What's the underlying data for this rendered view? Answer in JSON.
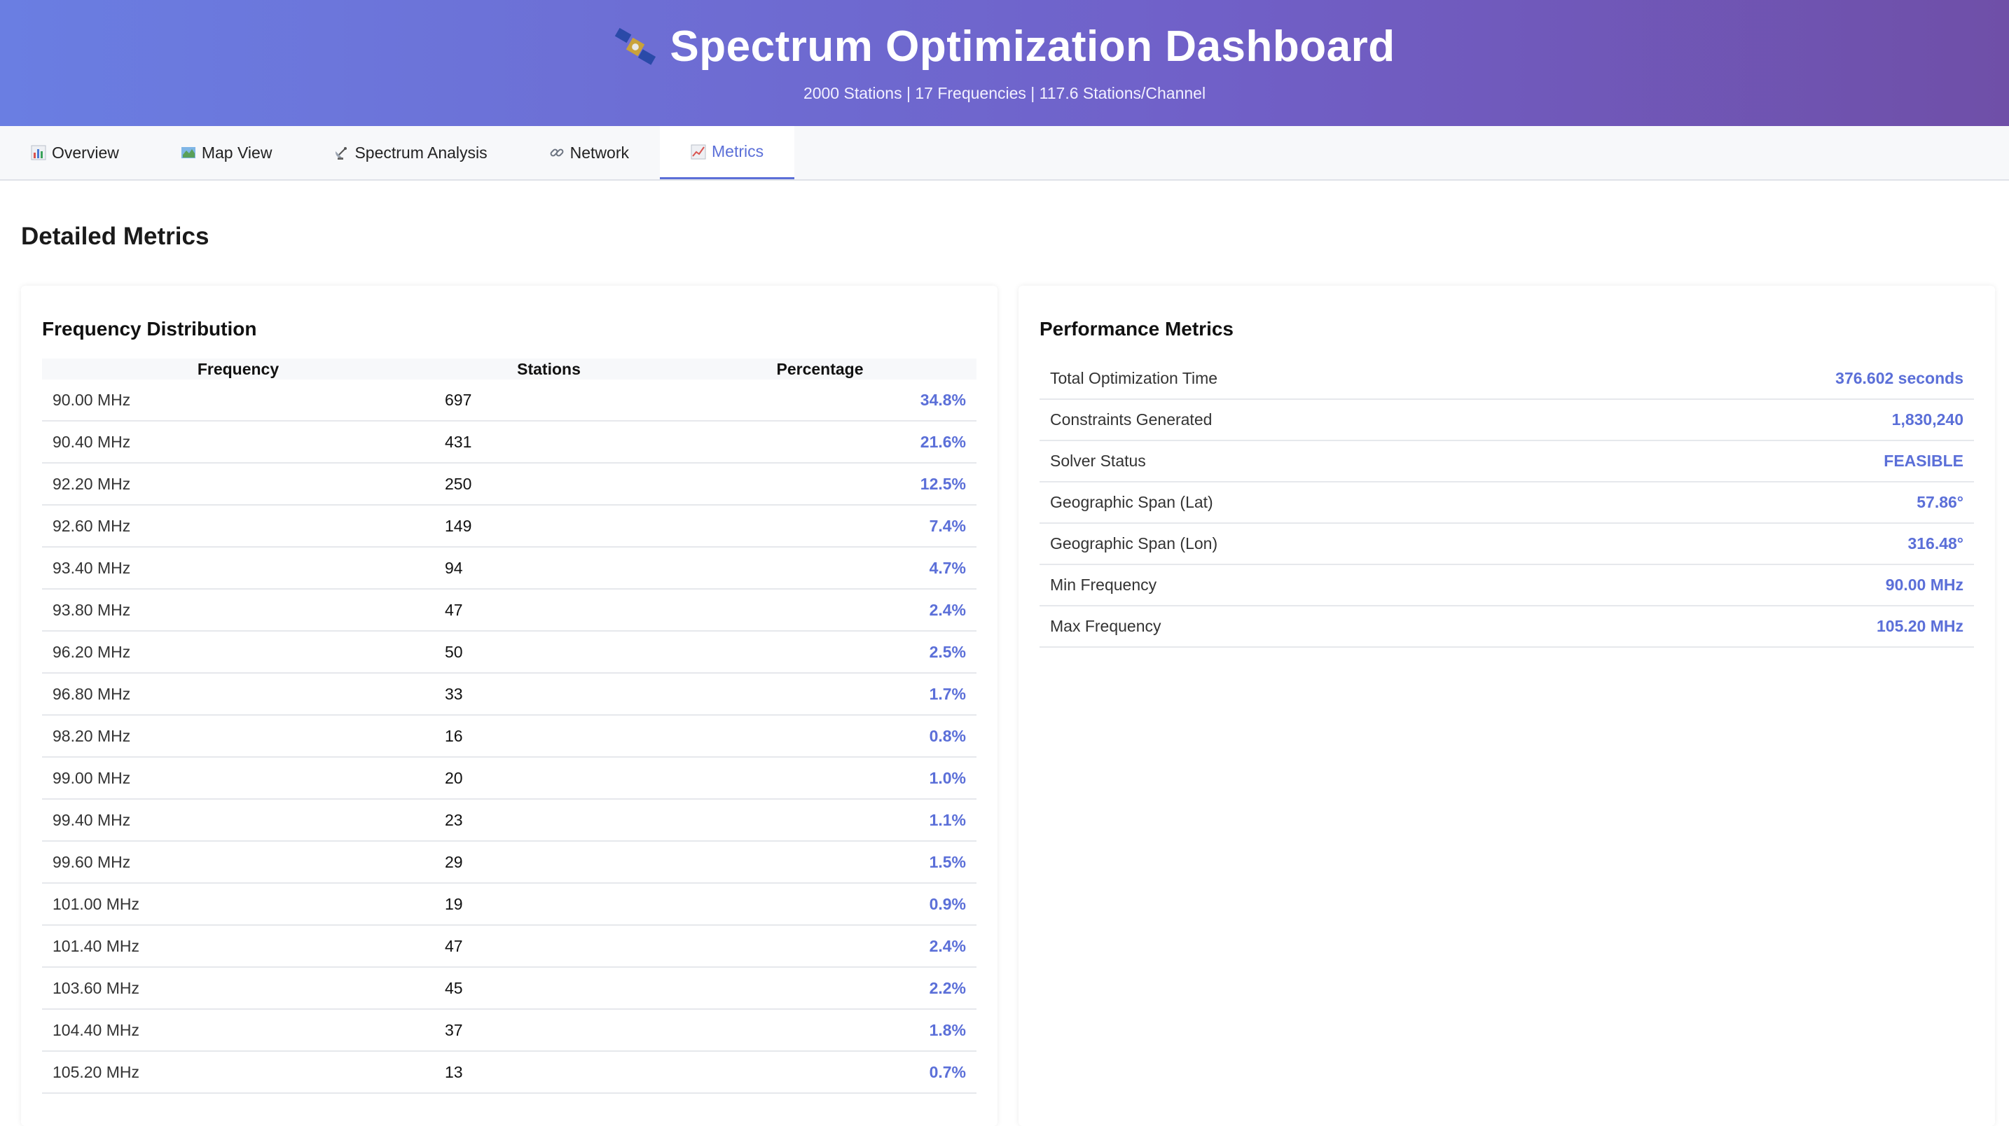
{
  "header": {
    "title": "Spectrum Optimization Dashboard",
    "subtitle": "2000 Stations | 17 Frequencies | 117.6 Stations/Channel",
    "icon": "satellite-icon"
  },
  "tabs": [
    {
      "label": "Overview",
      "icon": "bar-chart-icon"
    },
    {
      "label": "Map View",
      "icon": "map-icon"
    },
    {
      "label": "Spectrum Analysis",
      "icon": "satellite-dish-icon"
    },
    {
      "label": "Network",
      "icon": "link-icon"
    },
    {
      "label": "Metrics",
      "icon": "line-chart-icon",
      "active": true
    }
  ],
  "page_title": "Detailed Metrics",
  "frequency_distribution": {
    "title": "Frequency Distribution",
    "columns": [
      "Frequency",
      "Stations",
      "Percentage"
    ],
    "rows": [
      {
        "frequency": "90.00 MHz",
        "stations": "697",
        "percentage": "34.8%"
      },
      {
        "frequency": "90.40 MHz",
        "stations": "431",
        "percentage": "21.6%"
      },
      {
        "frequency": "92.20 MHz",
        "stations": "250",
        "percentage": "12.5%"
      },
      {
        "frequency": "92.60 MHz",
        "stations": "149",
        "percentage": "7.4%"
      },
      {
        "frequency": "93.40 MHz",
        "stations": "94",
        "percentage": "4.7%"
      },
      {
        "frequency": "93.80 MHz",
        "stations": "47",
        "percentage": "2.4%"
      },
      {
        "frequency": "96.20 MHz",
        "stations": "50",
        "percentage": "2.5%"
      },
      {
        "frequency": "96.80 MHz",
        "stations": "33",
        "percentage": "1.7%"
      },
      {
        "frequency": "98.20 MHz",
        "stations": "16",
        "percentage": "0.8%"
      },
      {
        "frequency": "99.00 MHz",
        "stations": "20",
        "percentage": "1.0%"
      },
      {
        "frequency": "99.40 MHz",
        "stations": "23",
        "percentage": "1.1%"
      },
      {
        "frequency": "99.60 MHz",
        "stations": "29",
        "percentage": "1.5%"
      },
      {
        "frequency": "101.00 MHz",
        "stations": "19",
        "percentage": "0.9%"
      },
      {
        "frequency": "101.40 MHz",
        "stations": "47",
        "percentage": "2.4%"
      },
      {
        "frequency": "103.60 MHz",
        "stations": "45",
        "percentage": "2.2%"
      },
      {
        "frequency": "104.40 MHz",
        "stations": "37",
        "percentage": "1.8%"
      },
      {
        "frequency": "105.20 MHz",
        "stations": "13",
        "percentage": "0.7%"
      }
    ]
  },
  "performance_metrics": {
    "title": "Performance Metrics",
    "items": [
      {
        "label": "Total Optimization Time",
        "value": "376.602 seconds"
      },
      {
        "label": "Constraints Generated",
        "value": "1,830,240"
      },
      {
        "label": "Solver Status",
        "value": "FEASIBLE"
      },
      {
        "label": "Geographic Span (Lat)",
        "value": "57.86°"
      },
      {
        "label": "Geographic Span (Lon)",
        "value": "316.48°"
      },
      {
        "label": "Min Frequency",
        "value": "90.00 MHz"
      },
      {
        "label": "Max Frequency",
        "value": "105.20 MHz"
      }
    ]
  },
  "colors": {
    "accent": "#5b6fd8",
    "header_gradient_start": "#6a7ee2",
    "header_gradient_end": "#6f4fa8"
  }
}
